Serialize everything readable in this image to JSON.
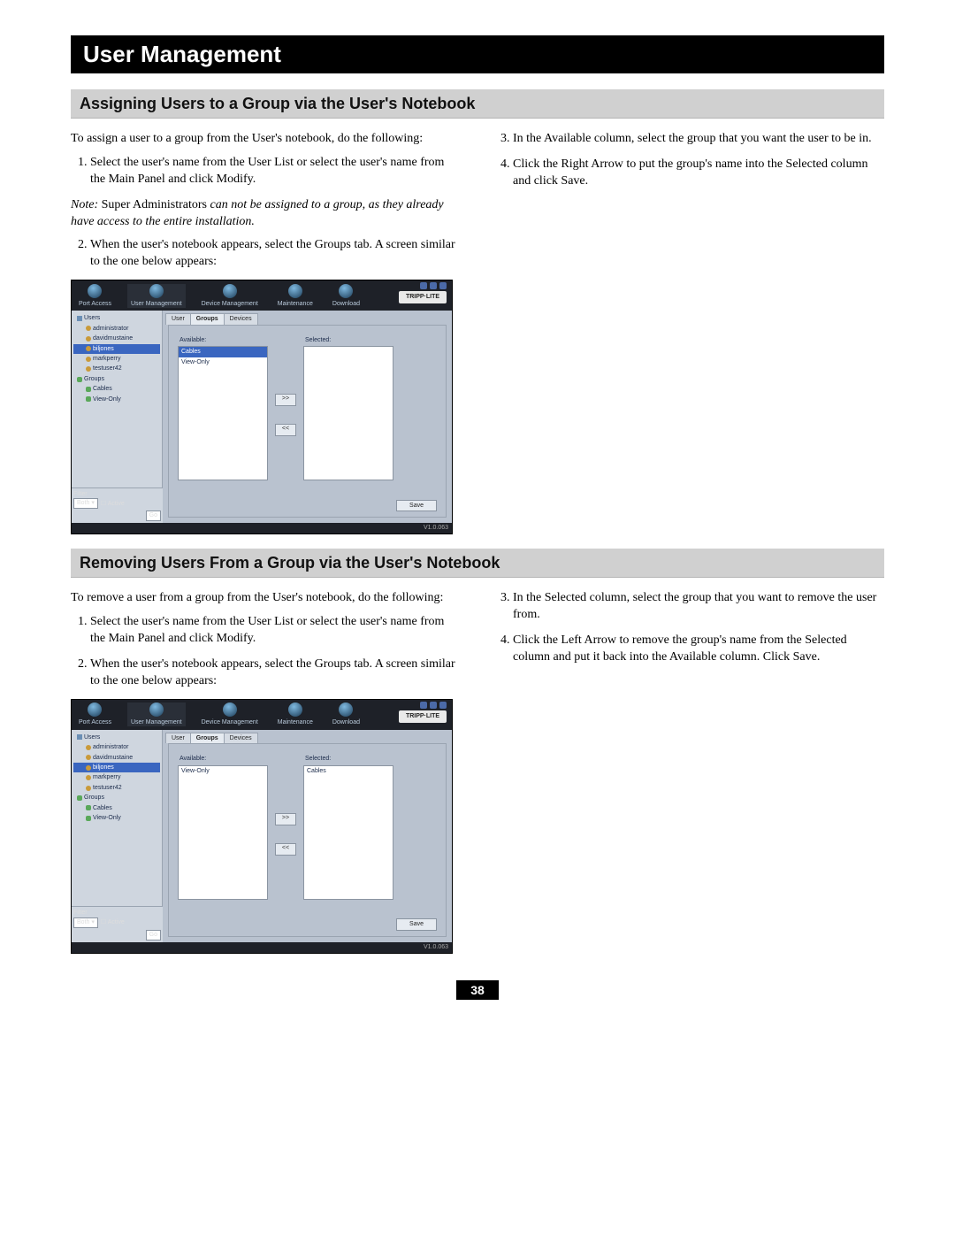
{
  "page_number": "38",
  "main_header": "User Management",
  "section1": {
    "title": "Assigning Users to a Group via the User's Notebook",
    "intro": "To assign a user to a group from the User's notebook, do the following:",
    "steps_left": [
      "Select the user's name from the User List or select the user's name from the Main Panel and click Modify.",
      "When the user's notebook appears, select the Groups tab. A screen similar to the one below appears:"
    ],
    "note_label": "Note:",
    "note_prefix": " Super Administrators ",
    "note_rest": "can not be assigned to a group, as they already have access to the entire installation.",
    "steps_right": [
      "In the Available column, select the group that you want the user to be in.",
      "Click the Right Arrow to put the group's name into the Selected column and click Save."
    ]
  },
  "section2": {
    "title": "Removing Users From a Group via the User's Notebook",
    "intro": "To remove a user from a group from the User's notebook, do the following:",
    "steps_left": [
      "Select the user's name from the User List or select the user's name from the Main Panel and click Modify.",
      "When the user's notebook appears, select the Groups tab. A screen similar to the one below appears:"
    ],
    "steps_right": [
      "In the Selected column, select the group that you want to remove the user from.",
      "Click the Left Arrow to remove the group's name from the Selected column and put it back into the Available column. Click Save."
    ]
  },
  "ui": {
    "brand": "TRIPP·LITE",
    "version": "V1.0.063",
    "nav": [
      "Port Access",
      "User Management",
      "Device Management",
      "Maintenance",
      "Download"
    ],
    "tabs": [
      "User",
      "Groups",
      "Devices"
    ],
    "tree": {
      "users_root": "Users",
      "users": [
        "administrator",
        "davidmustaine",
        "markperry",
        "testuser42"
      ],
      "selected_user": "biljones",
      "groups_root": "Groups",
      "groups": [
        "Cables",
        "View-Only"
      ]
    },
    "filter": {
      "label": "Filter",
      "dropdown": "Both",
      "checkbox": "Active",
      "go": "Go"
    },
    "panel": {
      "available_label": "Available:",
      "selected_label": "Selected:",
      "right_arrow": ">>",
      "left_arrow": "<<",
      "save": "Save"
    }
  },
  "screenshot1": {
    "available": [
      "Cables",
      "View-Only"
    ],
    "available_selected_index": 0,
    "selected": []
  },
  "screenshot2": {
    "available": [
      "View-Only"
    ],
    "selected": [
      "Cables"
    ]
  }
}
